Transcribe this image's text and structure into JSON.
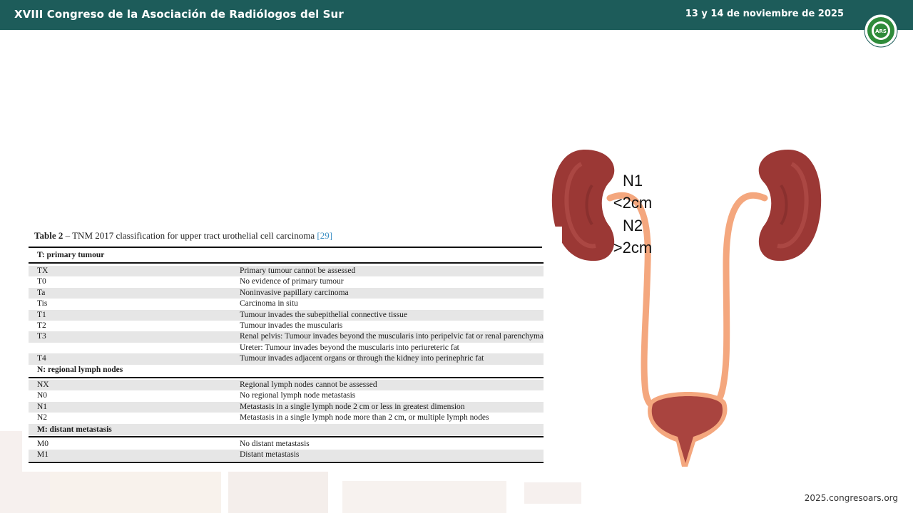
{
  "header": {
    "title": "XVIII Congreso de la Asociación de Radiólogos del Sur",
    "date": "13 y 14 de noviembre de 2025",
    "logo_text": "ARS",
    "logo_ring_text": "ASOCIACIÓN RADIÓLOGOS SUR",
    "brand_color": "#1d5c5a"
  },
  "footer": {
    "website": "2025.congresoars.org"
  },
  "table": {
    "caption_label": "Table 2",
    "caption_text": " – TNM 2017 classification for upper tract urothelial cell carcinoma ",
    "caption_ref": "[29]",
    "sections": [
      {
        "heading": "T: primary tumour",
        "rows": [
          {
            "code": "TX",
            "desc": "Primary tumour cannot be assessed"
          },
          {
            "code": "T0",
            "desc": "No evidence of primary tumour"
          },
          {
            "code": "Ta",
            "desc": "Noninvasive papillary carcinoma"
          },
          {
            "code": "Tis",
            "desc": "Carcinoma in situ"
          },
          {
            "code": "T1",
            "desc": "Tumour invades the subepithelial connective tissue"
          },
          {
            "code": "T2",
            "desc": "Tumour invades the muscularis"
          },
          {
            "code": "T3",
            "desc": "Renal pelvis: Tumour invades beyond the muscularis into peripelvic fat or renal parenchyma"
          },
          {
            "code": "",
            "desc": "Ureter: Tumour invades beyond the muscularis into periureteric fat"
          },
          {
            "code": "T4",
            "desc": "Tumour invades adjacent organs or through the kidney into perinephric fat"
          }
        ]
      },
      {
        "heading": "N: regional lymph nodes",
        "rows": [
          {
            "code": "NX",
            "desc": "Regional lymph nodes cannot be assessed"
          },
          {
            "code": "N0",
            "desc": "No regional lymph node metastasis"
          },
          {
            "code": "N1",
            "desc": "Metastasis in a single lymph node 2 cm or less in greatest dimension"
          },
          {
            "code": "N2",
            "desc": "Metastasis in a single lymph node more than 2 cm, or multiple lymph nodes"
          }
        ]
      },
      {
        "heading": "M: distant metastasis",
        "rows": [
          {
            "code": "M0",
            "desc": "No distant metastasis"
          },
          {
            "code": "M1",
            "desc": "Distant metastasis"
          }
        ]
      }
    ]
  },
  "diagram": {
    "n1_label": "N1",
    "n1_size": "<2cm",
    "n2_label": "N2",
    "n2_size": ">2cm",
    "kidney_color": "#9b3835",
    "ureter_color": "#f4a77e"
  }
}
